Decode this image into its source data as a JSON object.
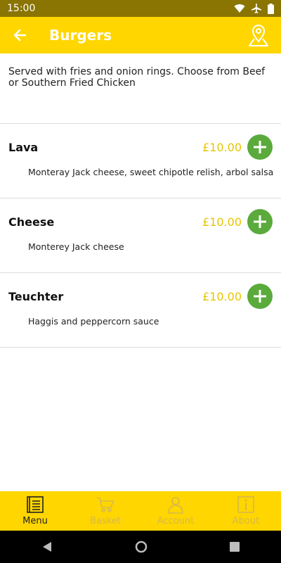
{
  "status_bar": {
    "time": "15:00"
  },
  "app_bar": {
    "title": "Burgers"
  },
  "description": "Served with fries and onion rings.  Choose from Beef or Southern Fried Chicken",
  "items": [
    {
      "name": "Lava",
      "price": "£10.00",
      "detail": "Monteray Jack cheese, sweet chipotle relish, arbol salsa"
    },
    {
      "name": "Cheese",
      "price": "£10.00",
      "detail": "Monterey Jack cheese"
    },
    {
      "name": "Teuchter",
      "price": "£10.00",
      "detail": "Haggis and peppercorn sauce"
    }
  ],
  "bottom_nav": [
    {
      "label": "Menu",
      "icon": "menu-book-icon",
      "active": true
    },
    {
      "label": "Basket",
      "icon": "cart-icon",
      "active": false
    },
    {
      "label": "Account",
      "icon": "person-icon",
      "active": false
    },
    {
      "label": "About",
      "icon": "info-icon",
      "active": false
    }
  ],
  "colors": {
    "accent": "#ffd600",
    "status_bar": "#8a7402",
    "price": "#e6c600",
    "add_button": "#5aaa3c"
  }
}
